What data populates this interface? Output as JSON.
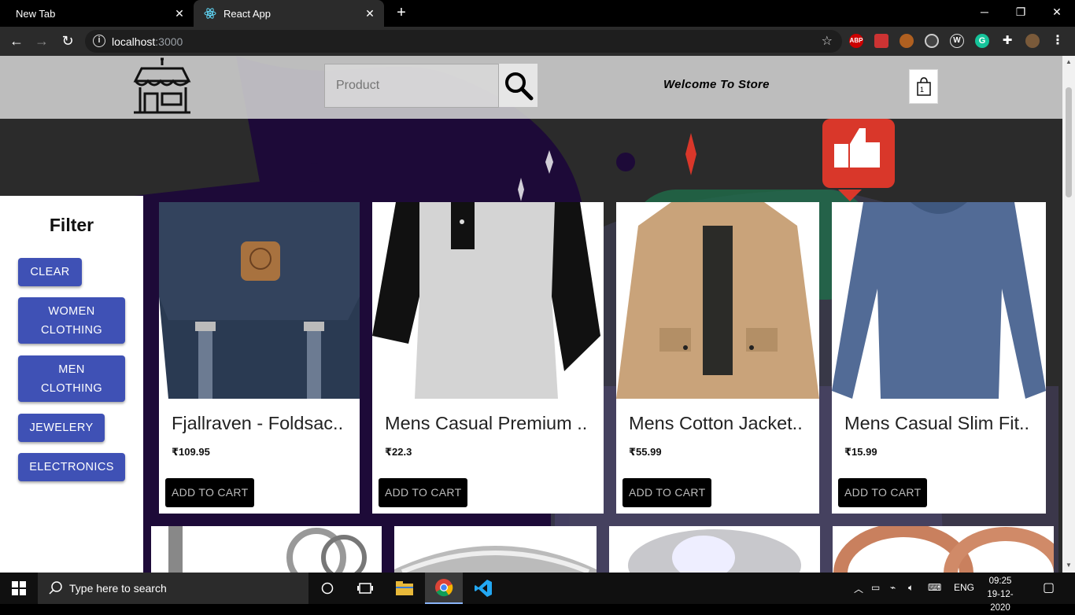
{
  "browser": {
    "tabs": [
      {
        "label": "New Tab",
        "active": false
      },
      {
        "label": "React App",
        "active": true
      }
    ],
    "url_host": "localhost",
    "url_port": ":3000",
    "extensions": [
      "ABP",
      "shield",
      "cookie",
      "target",
      "W",
      "G",
      "puzzle",
      "avatar"
    ]
  },
  "header": {
    "search_placeholder": "Product",
    "welcome_text": "Welcome To Store",
    "cart_count": "1"
  },
  "filter": {
    "title": "Filter",
    "buttons": [
      {
        "label": "CLEAR"
      },
      {
        "label": "WOMEN\nCLOTHING"
      },
      {
        "label": "MEN\nCLOTHING"
      },
      {
        "label": "JEWELERY"
      },
      {
        "label": "ELECTRONICS"
      }
    ]
  },
  "products": [
    {
      "title": "Fjallraven - Foldsac..",
      "price": "₹109.95",
      "button": "ADD TO CART"
    },
    {
      "title": "Mens Casual Premium ..",
      "price": "₹22.3",
      "button": "ADD TO CART"
    },
    {
      "title": "Mens Cotton Jacket..",
      "price": "₹55.99",
      "button": "ADD TO CART"
    },
    {
      "title": "Mens Casual Slim Fit..",
      "price": "₹15.99",
      "button": "ADD TO CART"
    }
  ],
  "taskbar": {
    "search_placeholder": "Type here to search",
    "language": "ENG",
    "time": "09:25",
    "date": "19-12-2020"
  },
  "colors": {
    "filter_button": "#3f51b5",
    "page_background": "#2b2b2b",
    "accent_purple": "#2a0a4a",
    "accent_red": "#d9372a"
  }
}
